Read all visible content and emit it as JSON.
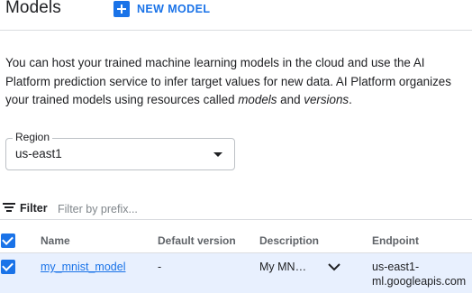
{
  "header": {
    "title": "Models",
    "new_model_label": "NEW MODEL"
  },
  "description": {
    "part1": "You can host your trained machine learning models in the cloud and use the AI Platform prediction service to infer target values for new data. AI Platform organizes your trained models using resources called ",
    "models_word": "models",
    "and_word": " and ",
    "versions_word": "versions",
    "end": "."
  },
  "region": {
    "label": "Region",
    "value": "us-east1"
  },
  "filter": {
    "label": "Filter",
    "placeholder": "Filter by prefix..."
  },
  "table": {
    "columns": [
      "Name",
      "Default version",
      "Description",
      "Endpoint"
    ],
    "rows": [
      {
        "name": "my_mnist_model",
        "default_version": "-",
        "description": "My MN…",
        "endpoint_line1": "us-east1-",
        "endpoint_line2": "ml.googleapis.com"
      }
    ]
  },
  "colors": {
    "accent": "#1a73e8",
    "selected_row": "#e8f0fe",
    "divider": "#dadce0"
  },
  "icons": [
    "plus-icon",
    "dropdown-arrow-icon",
    "filter-icon",
    "checkbox-checked-icon",
    "chevron-down-icon"
  ]
}
